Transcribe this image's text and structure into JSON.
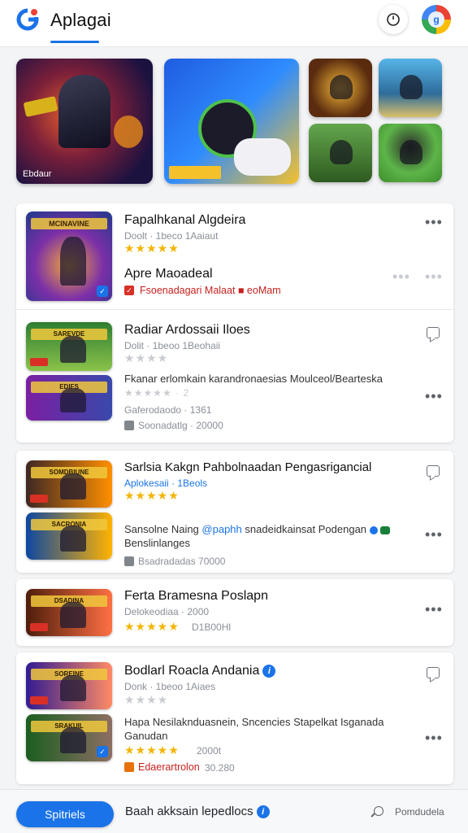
{
  "header": {
    "app_title": "Aplagai",
    "logo_letter": "G",
    "avatar_letter": "g",
    "icons": [
      "google-logo-icon",
      "clock-icon",
      "avatar-icon"
    ]
  },
  "banner": {
    "main_caption": "Ebdaur",
    "tiles": [
      "hero-tile",
      "game-controller-tile",
      "tile-1",
      "tile-2",
      "tile-3",
      "tile-4"
    ]
  },
  "cards": {
    "c1": {
      "title": "Fapalhkanal Algdeira",
      "meta": "Doolt · 1beco 1Aaiaut",
      "rating_stars": "★★★★★",
      "subtitle": "Apre Maoadeal",
      "link": "Fsoenadagari Malaat ■ eoMam",
      "thumb_label": "MCINAVINE"
    },
    "c2": {
      "title": "Radiar Ardossaii Iloes",
      "meta": "Dolit · 1beoo 1Beohaii",
      "rating_stars": "★★★★",
      "body": "Fkanar erlomkain karandronaesias Moulceol/Bearteska",
      "sub_rating": "★★★★★ · 2",
      "meta2": "Gaferodaodo · 1361",
      "meta3": "Soonadatlg · 20000",
      "thumb1_label": "SAREVDE",
      "thumb2_label": "EDIFS"
    },
    "c3": {
      "title": "Sarlsia Kakgn Pahbolnaadan Pengasrigancial",
      "link": "Aplokesaii · 1Beols",
      "rating_stars": "★★★★★",
      "body_a": "Sansolne Naing",
      "body_link": "@paphh",
      "body_b": "snadeidkainsat Podengan",
      "body_c": "Benslinlanges",
      "meta": "Bsadradadas 70000",
      "thumb1_label": "SOMDBIUNE",
      "thumb2_label": "SACRONIA"
    },
    "c4": {
      "title": "Ferta Bramesna Poslapn",
      "meta": "Delokeodiaa · 2000",
      "rating_stars": "★★★★★",
      "rating_count": "D1B00Hl",
      "thumb_label": "DSADINA"
    },
    "c5": {
      "title": "Bodlarl Roacla Andania",
      "meta": "Donk · 1beoo 1Aiaes",
      "rating_stars": "★★★★",
      "body_line1": "Hapa Nesilaknduasnein, Sncencies Stapelkat Isganada",
      "body_line2": "Ganudan",
      "rating2": "★★★★★",
      "rating2_count": "2000t",
      "link": "Edaerartrolon",
      "link_count": "30.280",
      "thumb1_label": "SOREINE",
      "thumb2_label": "SRAKUIL"
    }
  },
  "bottom_bar": {
    "primary_button": "Spitriels",
    "text": "Baah akksain lepedlocs",
    "search_label": "Pomdudela"
  },
  "colors": {
    "accent": "#1a73e8",
    "star": "#f4b400",
    "link_red": "#c5221f",
    "background": "#f3f4f6"
  }
}
